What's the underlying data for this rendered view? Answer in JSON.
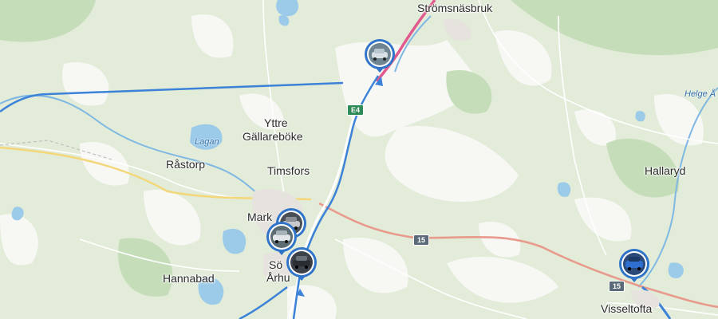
{
  "places": [
    {
      "id": "stromsnasbruk",
      "name": "Strömsnäsbruk"
    },
    {
      "id": "yttre",
      "name": "Yttre"
    },
    {
      "id": "gallareboke",
      "name": "Gällareböke"
    },
    {
      "id": "rastorp",
      "name": "Råstorp"
    },
    {
      "id": "timsfors",
      "name": "Timsfors"
    },
    {
      "id": "markaryd",
      "name": "Mark"
    },
    {
      "id": "hannabad",
      "name": "Hannabad"
    },
    {
      "id": "sodra",
      "name": "Sö"
    },
    {
      "id": "arhult",
      "name": "Århu"
    },
    {
      "id": "hallaryd",
      "name": "Hallaryd"
    },
    {
      "id": "visseltofta",
      "name": "Visseltofta"
    }
  ],
  "water_labels": [
    {
      "id": "lagan",
      "name": "Lagan"
    },
    {
      "id": "helge-a",
      "name": "Helge Å"
    }
  ],
  "road_shields": [
    {
      "id": "e4",
      "label": "E4",
      "type": "european"
    },
    {
      "id": "rv15-mid",
      "label": "15",
      "type": "national"
    },
    {
      "id": "rv15-east",
      "label": "15",
      "type": "national"
    }
  ],
  "colors": {
    "forest": "#cfe3c5",
    "open_land": "#f7f7f4",
    "water": "#9ccbea",
    "road_main": "#ffffff",
    "route_blue": "#3b82d8",
    "marker_blue": "#2f74c8"
  },
  "markers": [
    {
      "id": "car-north",
      "icon": "car-photo-icon"
    },
    {
      "id": "car-mark-1",
      "icon": "car-photo-icon"
    },
    {
      "id": "car-mark-2",
      "icon": "car-photo-icon"
    },
    {
      "id": "car-mark-3",
      "icon": "car-photo-icon"
    },
    {
      "id": "car-east",
      "icon": "car-photo-icon"
    }
  ]
}
